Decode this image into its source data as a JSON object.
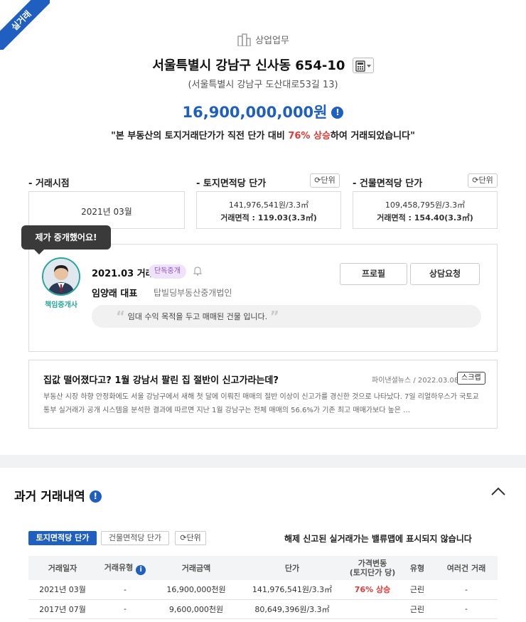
{
  "ribbon": "실거래",
  "property": {
    "category": "상업업무",
    "address": "서울특별시 강남구 신사동 654-10",
    "road_address": "(서울특별시 강남구 도산대로53길 13)",
    "price": "16,900,000,000원",
    "summary_prefix": "\"본 부동산의 토지거래단가가 직전 단가 대비 ",
    "summary_highlight": "76% 상승",
    "summary_suffix": "하여 거래되었습니다\""
  },
  "metrics": {
    "deal_time_label": "- 거래시점",
    "deal_time_value": "2021년 03월",
    "land_label": "- 토지면적당 단가",
    "land_unit_button": "단위",
    "land_price": "141,976,541원/3.3㎡",
    "land_area": "거래면적 : 119.03(3.3㎡)",
    "building_label": "- 건물면적당 단가",
    "building_unit_button": "단위",
    "building_price": "109,458,795원/3.3㎡",
    "building_area": "거래면적 : 154.40(3.3㎡)"
  },
  "agent": {
    "tooltip": "제가 중개했어요!",
    "tag": "책임중개사",
    "deal_date": "2021.03 거래",
    "badge": "단독중개",
    "name": "임양래 대표",
    "agency": "탑빌딩부동산중개법인",
    "profile_button": "프로필",
    "consult_button": "상담요청",
    "comment": "임대 수익 목적을 두고 매매된 건물 입니다."
  },
  "news": {
    "title": "집값 떨어졌다고? 1월 강남서 팔린 집 절반이 신고가라는데?",
    "source": "파이낸셜뉴스  /  2022.03.08",
    "scrap": "스크랩",
    "body": "부동산 시장 하향 안정화에도 서울 강남구에서 새해 첫 달에 이뤄진 매매의 절반 이상이 신고가를 경신한 것으로 나타났다. 7일 리얼하우스가 국토교통부 실거래가 공개 시스템을 분석한 결과에 따르면 지난 1월 강남구는 전체 매매의 56.6%가 기존 최고 매매가보다 높은 …"
  },
  "history": {
    "title": "과거 거래내역",
    "tab_land": "토지면적당 단가",
    "tab_building": "건물면적당 단가",
    "unit_button": "단위",
    "notice": "해제 신고된 실거래가는 밸류맵에 표시되지 않습니다",
    "headers": {
      "date": "거래일자",
      "type": "거래유형",
      "amount": "거래금액",
      "unit_price": "단가",
      "change_1": "가격변동",
      "change_2": "(토지단가 당)",
      "kind": "유형",
      "multi": "여러건 거래"
    },
    "rows": [
      {
        "date": "2021년 03월",
        "type": "-",
        "amount": "16,900,000천원",
        "unit_price": "141,976,541원/3.3㎡",
        "change": "76% 상승",
        "kind": "근린",
        "multi": "-"
      },
      {
        "date": "2017년 07월",
        "type": "-",
        "amount": "9,600,000천원",
        "unit_price": "80,649,396원/3.3㎡",
        "change": "",
        "kind": "근린",
        "multi": "-"
      }
    ]
  },
  "colors": {
    "accent": "#1f5fbf",
    "up": "#e53935",
    "agent": "#26a69a",
    "badge": "#8a4fc7"
  }
}
